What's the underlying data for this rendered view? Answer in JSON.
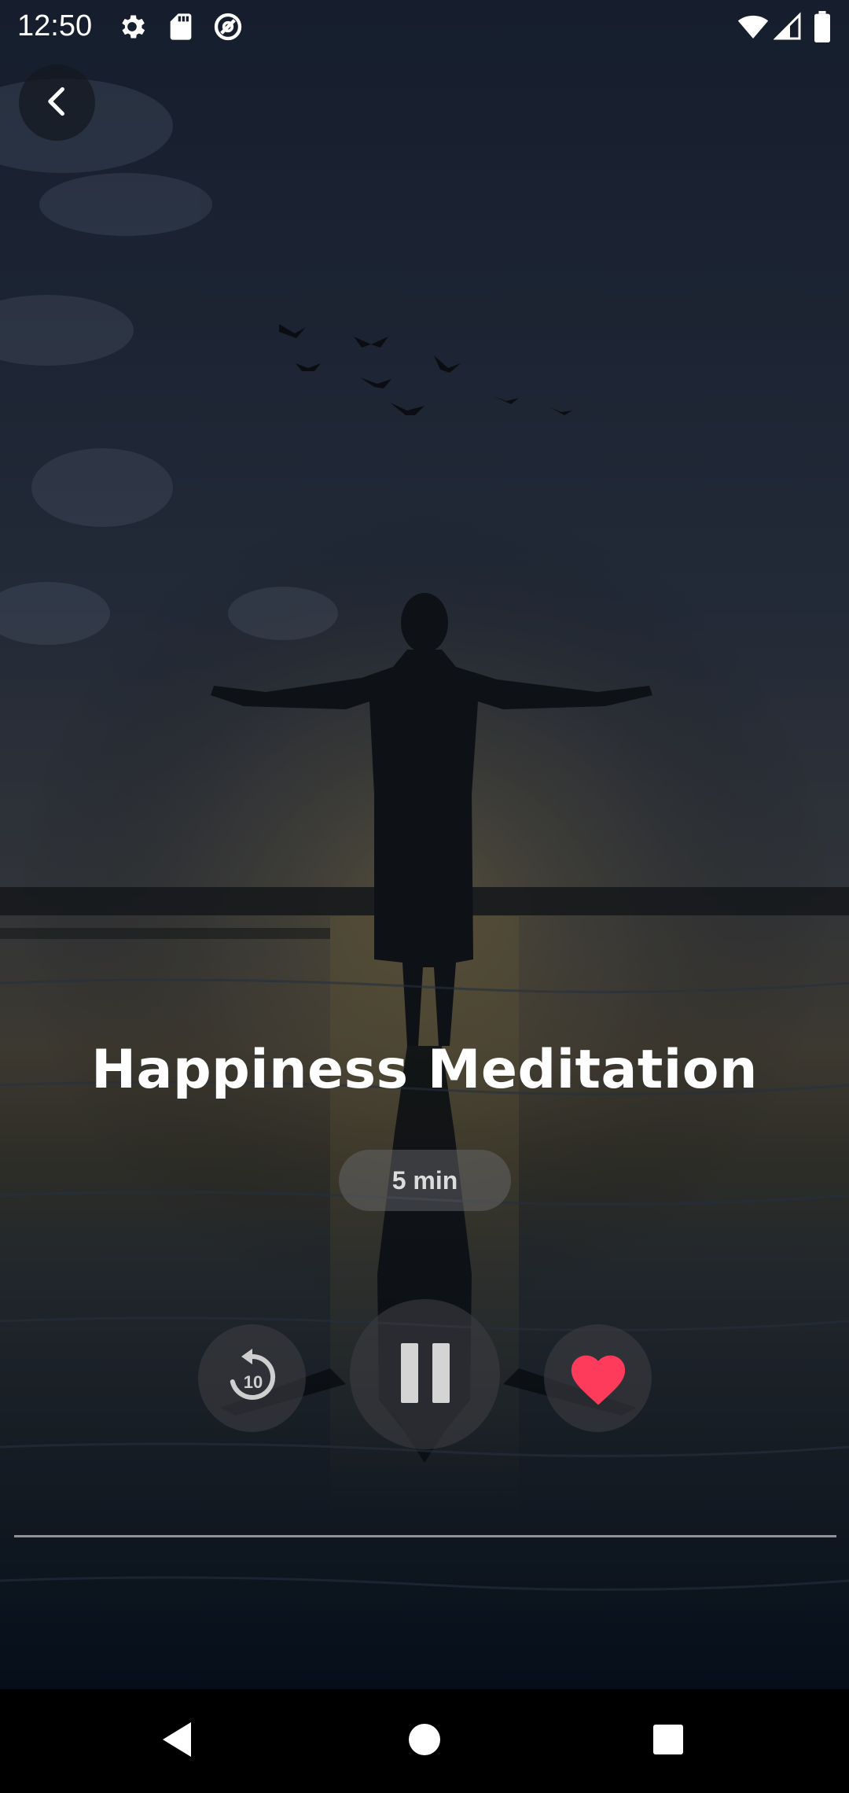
{
  "status_bar": {
    "time": "12:50",
    "left_icons": [
      "settings-icon",
      "sd-card-icon",
      "data-saver-icon"
    ],
    "right_icons": [
      "wifi-icon",
      "cell-signal-icon",
      "battery-icon"
    ]
  },
  "header": {
    "back_icon": "chevron-left-icon"
  },
  "session": {
    "title": "Happiness Meditation",
    "duration": "5 min"
  },
  "controls": {
    "rewind_seconds": "10",
    "rewind_icon": "replay-10-icon",
    "play_pause_icon": "pause-icon",
    "favorite_icon": "heart-icon",
    "favorite_active": true
  },
  "progress": {
    "fraction": 0.0
  },
  "nav_bar": {
    "items": [
      "back-triangle-icon",
      "home-circle-icon",
      "recents-square-icon"
    ]
  },
  "colors": {
    "heart": "#ff3b5c",
    "text": "#ffffff",
    "sky_top": "#1a2436",
    "water_bottom": "#07101d"
  }
}
